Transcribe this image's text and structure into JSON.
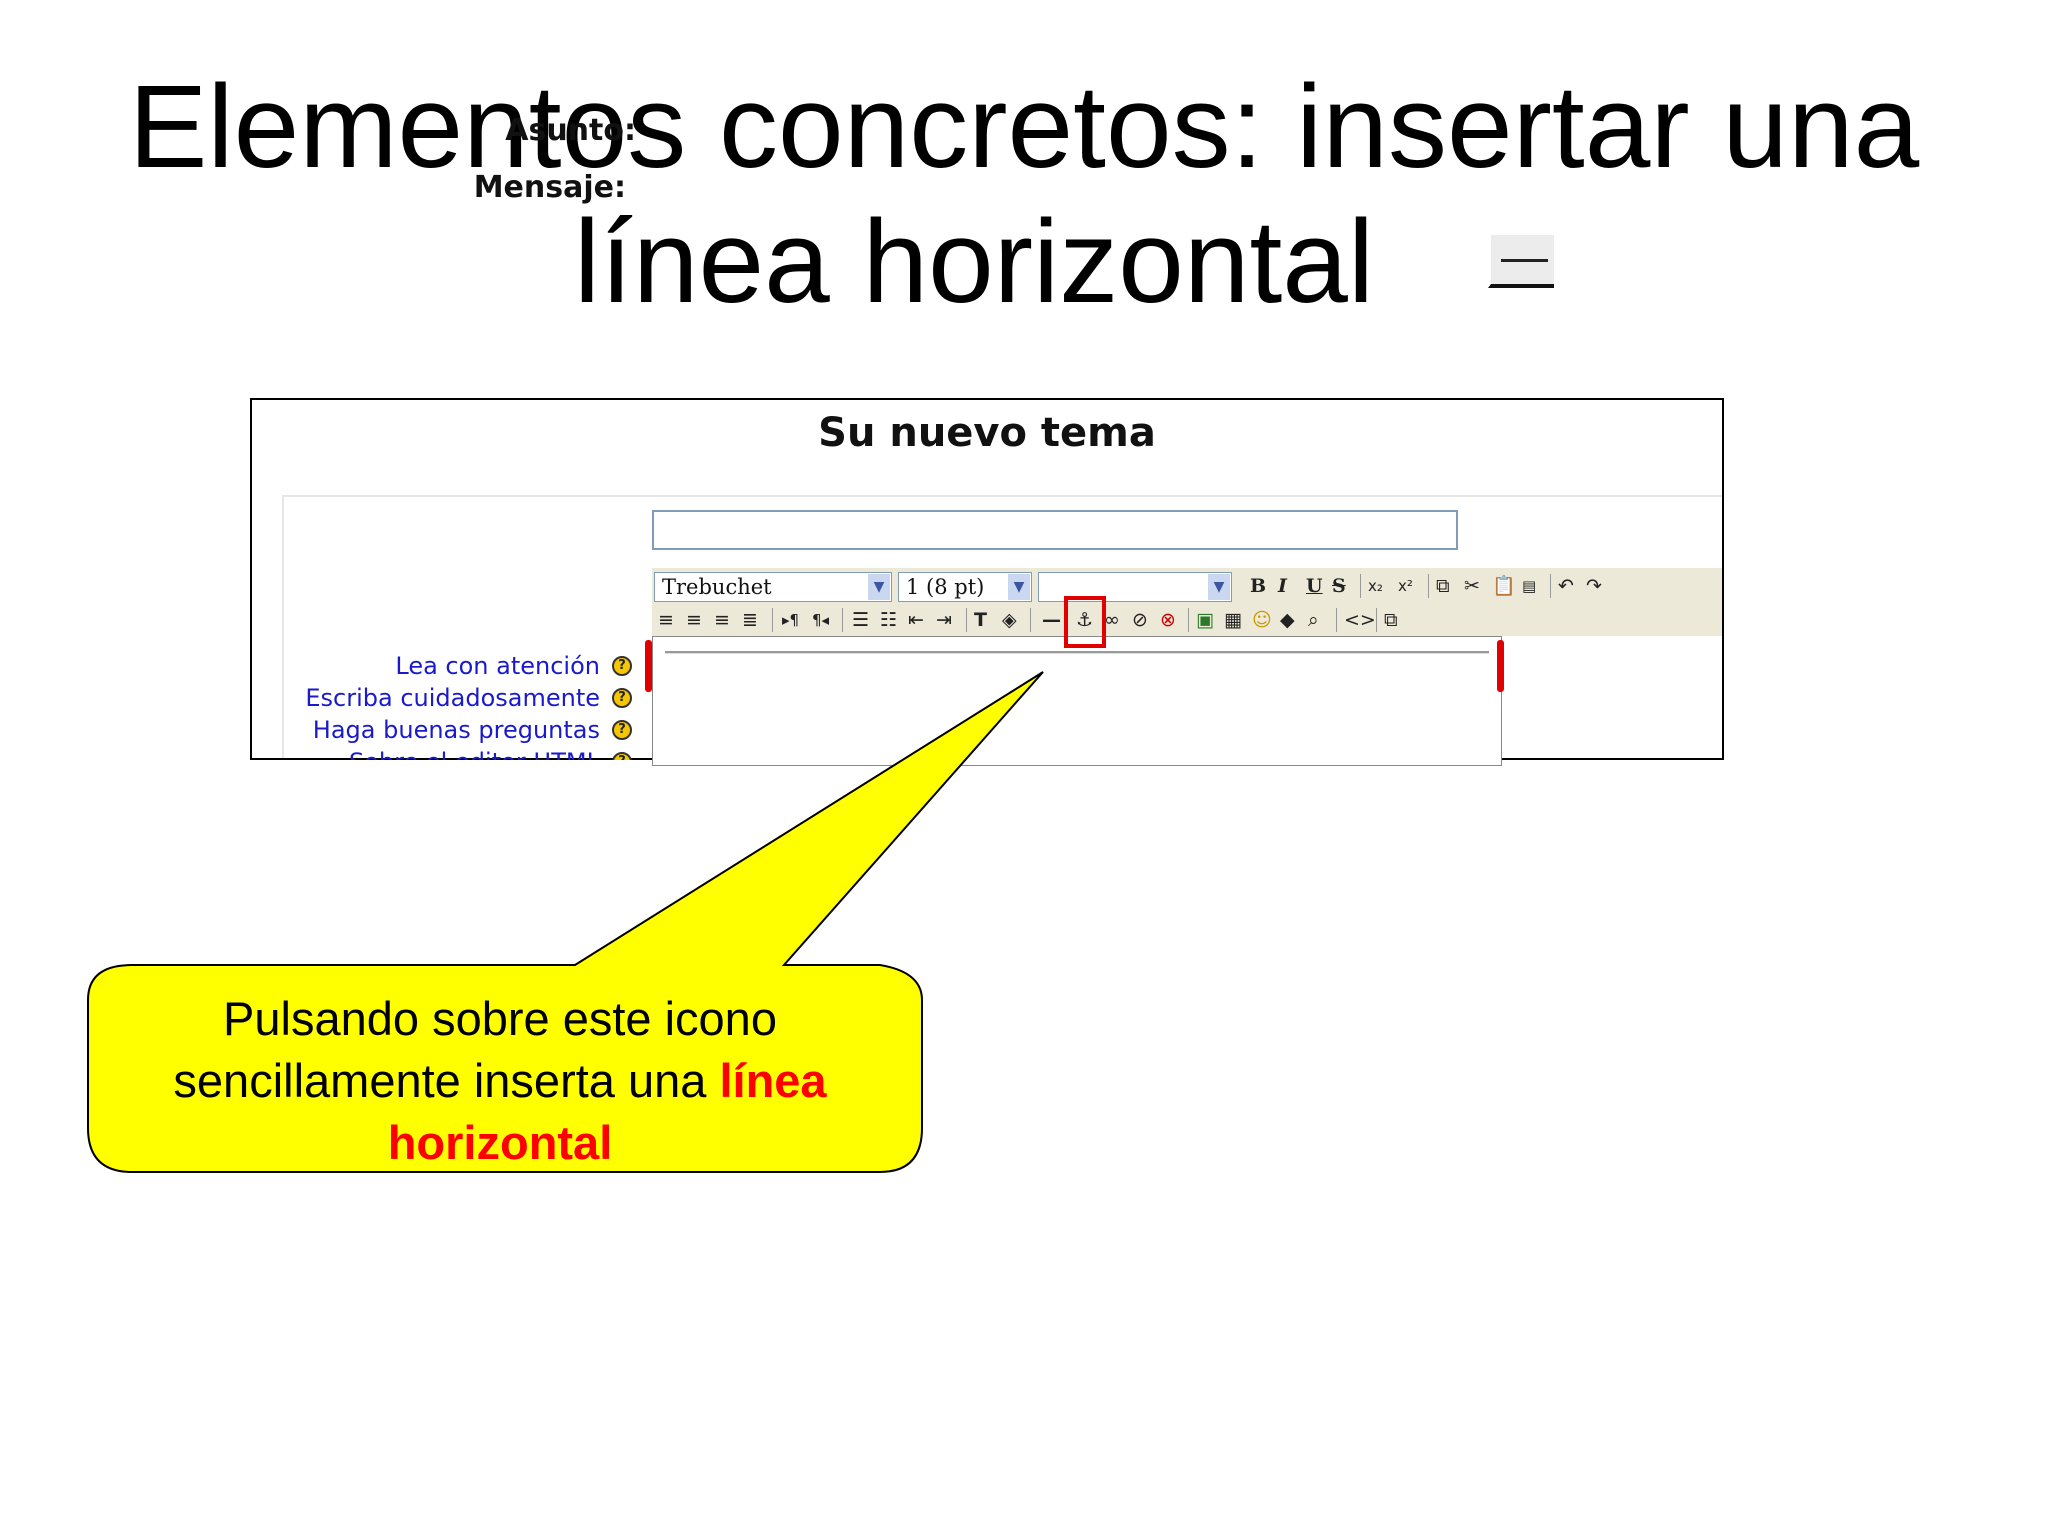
{
  "slide": {
    "title_line1": "Elementos concretos: insertar una",
    "title_line2": "línea horizontal"
  },
  "form": {
    "title": "Su nuevo tema",
    "subject_label": "Asunto:",
    "message_label": "Mensaje:",
    "font_select": "Trebuchet",
    "size_select": "1 (8 pt)",
    "format_select": "",
    "help_links": [
      "Lea con atención",
      "Escriba cuidadosamente",
      "Haga buenas preguntas",
      "Sobre el editor HTML"
    ]
  },
  "toolbar": {
    "bold": "B",
    "italic": "I",
    "underline": "U",
    "strike": "S",
    "subscript": "x₂",
    "superscript": "x²"
  },
  "callout": {
    "text_part1": "Pulsando sobre este icono",
    "text_part2": "sencillamente inserta una ",
    "text_emph1": "línea",
    "text_emph2": "horizontal"
  },
  "colors": {
    "highlight": "#e00000",
    "callout_fill": "#ffff00",
    "link": "#1a1acc"
  }
}
